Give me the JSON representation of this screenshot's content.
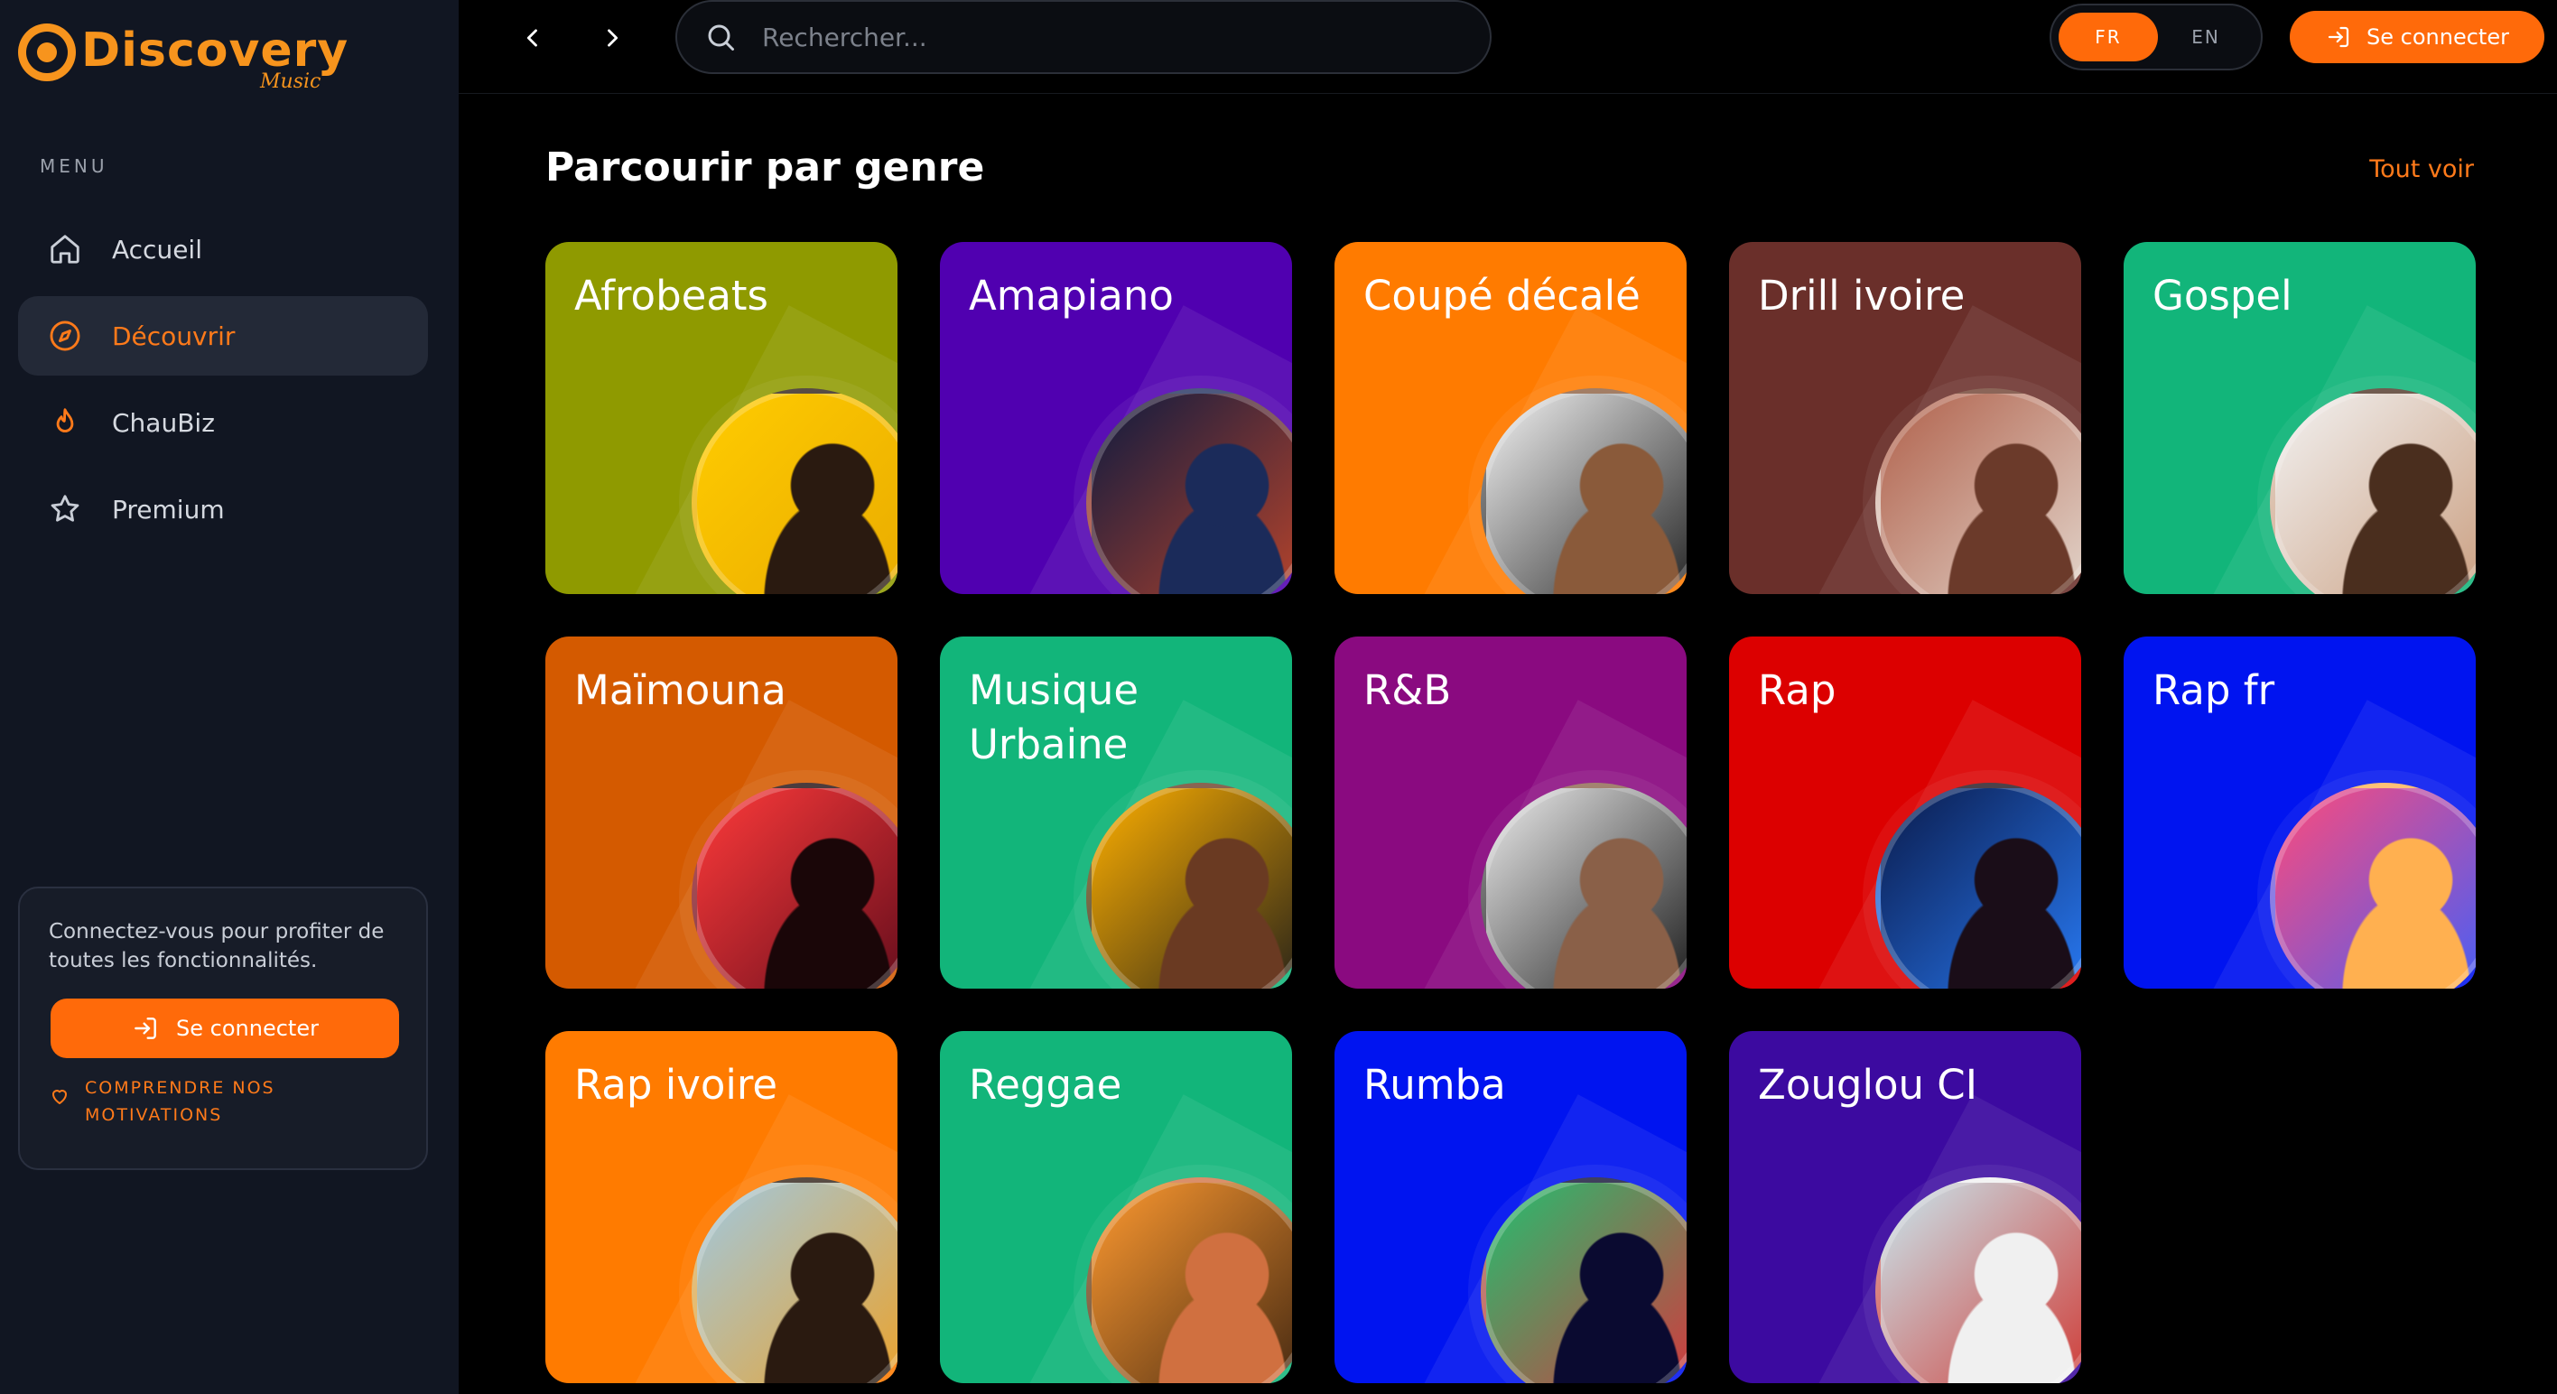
{
  "brand": {
    "name": "Discovery",
    "tagline": "Music",
    "accent": "#ff6a0a",
    "logo_color": "#f7941d"
  },
  "sidebar": {
    "menu_label": "MENU",
    "items": [
      {
        "label": "Accueil",
        "icon": "home-icon",
        "active": false
      },
      {
        "label": "Découvrir",
        "icon": "compass-icon",
        "active": true
      },
      {
        "label": "ChauBiz",
        "icon": "flame-icon",
        "active": false
      },
      {
        "label": "Premium",
        "icon": "star-icon",
        "active": false
      }
    ],
    "promo": {
      "text": "Connectez-vous pour profiter de toutes les fonctionnalités.",
      "button_label": "Se connecter",
      "link_label": "COMPRENDRE NOS MOTIVATIONS"
    }
  },
  "topbar": {
    "search_placeholder": "Rechercher...",
    "lang_fr": "FR",
    "lang_en": "EN",
    "selected_lang": "FR",
    "connect_label": "Se connecter"
  },
  "main": {
    "section_title": "Parcourir par genre",
    "see_all": "Tout voir",
    "genres": [
      {
        "title": "Afrobeats",
        "color": "#8f9a00",
        "photo": [
          "#ffcc00",
          "#e8a900",
          "#2a1a10"
        ]
      },
      {
        "title": "Amapiano",
        "color": "#5000b0",
        "photo": [
          "#0d1a40",
          "#c0462a",
          "#1b2b5a"
        ]
      },
      {
        "title": "Coupé décalé",
        "color": "#ff7b00",
        "photo": [
          "#f4f4f4",
          "#161616",
          "#8a5a3a"
        ]
      },
      {
        "title": "Drill ivoire",
        "color": "#6a2f2a",
        "photo": [
          "#b0604a",
          "#e6ddd4",
          "#6b3a2a"
        ]
      },
      {
        "title": "Gospel",
        "color": "#12b57a",
        "photo": [
          "#f2f2f2",
          "#c89a7a",
          "#4a2e1e"
        ]
      },
      {
        "title": "Maïmouna",
        "color": "#d45a00",
        "photo": [
          "#ff3a3a",
          "#5a0a1a",
          "#1a0608"
        ]
      },
      {
        "title": "Musique Urbaine",
        "color": "#12b57a",
        "photo": [
          "#ffb000",
          "#1a1a1a",
          "#6a3a22"
        ]
      },
      {
        "title": "R&B",
        "color": "#8a0a80",
        "photo": [
          "#ededed",
          "#0e0e0e",
          "#8a6048"
        ]
      },
      {
        "title": "Rap",
        "color": "#dc0000",
        "photo": [
          "#0a1a4a",
          "#2a80ff",
          "#1a0d18"
        ]
      },
      {
        "title": "Rap fr",
        "color": "#0014f0",
        "photo": [
          "#ff4a7a",
          "#3a60ff",
          "#ffb050"
        ]
      },
      {
        "title": "Rap ivoire",
        "color": "#ff7b00",
        "photo": [
          "#a0c8e0",
          "#f0a020",
          "#2a1a10"
        ]
      },
      {
        "title": "Reggae",
        "color": "#12b57a",
        "photo": [
          "#ff9a30",
          "#3a2210",
          "#d07040"
        ]
      },
      {
        "title": "Rumba",
        "color": "#0014f0",
        "photo": [
          "#20c070",
          "#e0303a",
          "#0a0a30"
        ]
      },
      {
        "title": "Zouglou CI",
        "color": "#3c0aa0",
        "photo": [
          "#c8e8f0",
          "#d0302a",
          "#f0f0f0"
        ]
      }
    ]
  }
}
